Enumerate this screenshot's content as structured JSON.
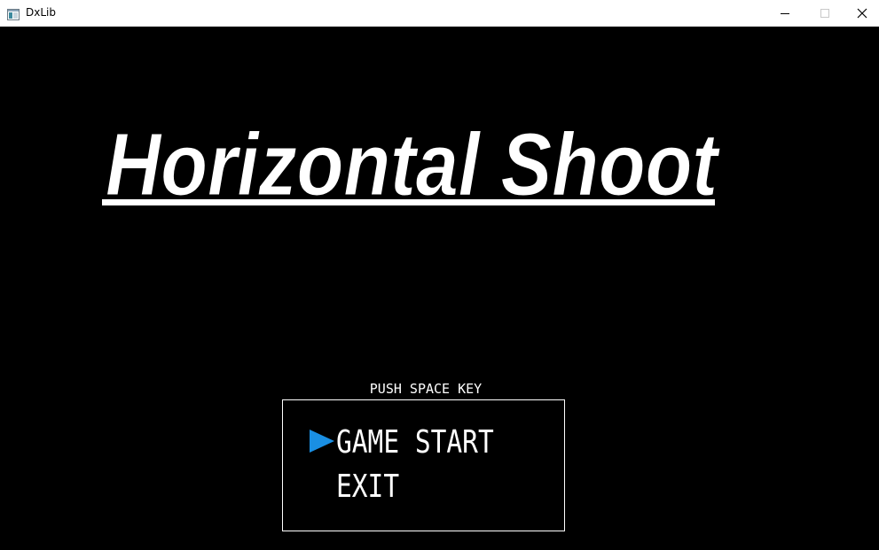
{
  "window": {
    "title": "DxLib"
  },
  "icons": {
    "app": "app-window-icon",
    "minimize": "minimize-icon",
    "maximize": "maximize-icon",
    "close": "close-icon",
    "cursor": "play-arrow-icon"
  },
  "game": {
    "title": "Horizontal Shoot",
    "prompt": "PUSH SPACE KEY",
    "menu": [
      {
        "label": "GAME START",
        "selected": true
      },
      {
        "label": "EXIT",
        "selected": false
      }
    ]
  },
  "colors": {
    "background": "#000000",
    "text": "#ffffff",
    "cursor": "#1a8fe3"
  }
}
